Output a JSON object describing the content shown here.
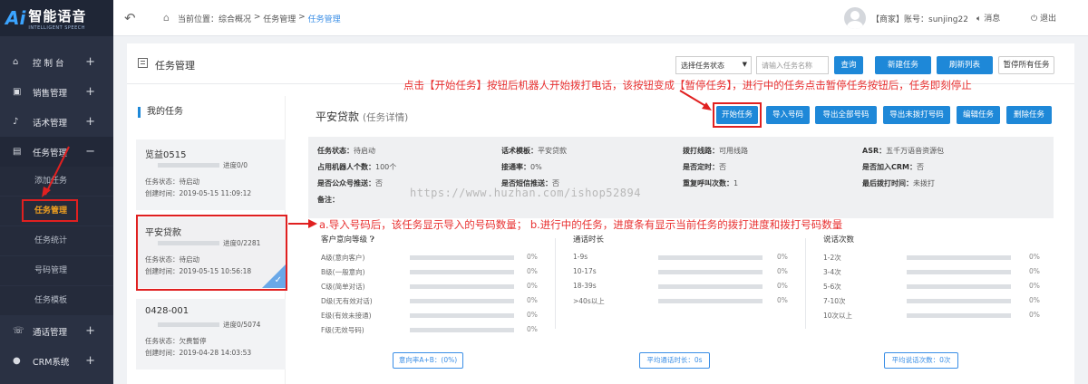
{
  "logo": {
    "ai": "Ai",
    "title": "智能语音",
    "sub": "INTELLIGENT SPEECH"
  },
  "sidebar": {
    "items": [
      {
        "label": "控 制 台",
        "icon": "home-icon",
        "sign": "+"
      },
      {
        "label": "销售管理",
        "icon": "clipboard-icon",
        "sign": "+"
      },
      {
        "label": "话术管理",
        "icon": "mic-icon",
        "sign": "+"
      },
      {
        "label": "任务管理",
        "icon": "task-icon",
        "sign": "−"
      },
      {
        "label": "通话管理",
        "icon": "phone-icon",
        "sign": "+"
      },
      {
        "label": "CRM系统",
        "icon": "user-icon",
        "sign": "+"
      }
    ],
    "subitems": [
      "添加任务",
      "任务管理",
      "任务统计",
      "号码管理",
      "任务模板"
    ]
  },
  "header": {
    "breadcrumb": [
      "当前位置：综合概况",
      "任务管理",
      "任务管理"
    ],
    "account": "【商家】账号：sunjing22",
    "message": "消息",
    "logout": "退出"
  },
  "panel": {
    "title": "任务管理",
    "status_select": "选择任务状态",
    "name_placeholder": "请输入任务名称",
    "search_btn": "查询",
    "new_btn": "新建任务",
    "refresh_btn": "刷新列表",
    "pause_all_btn": "暂停所有任务"
  },
  "annotations": {
    "top": "点击【开始任务】按钮后机器人开始拨打电话，该按钮变成【暂停任务】，进行中的任务点击暂停任务按钮后，任务即刻停止",
    "mid": "a.导入号码后，该任务显示导入的号码数量； b.进行中的任务，进度条有显示当前任务的拨打进度和拨打号码数量"
  },
  "my_tasks": {
    "heading": "我的任务",
    "tasks": [
      {
        "name": "览益0515",
        "progress": "进度0/0",
        "status": "任务状态：待启动",
        "created": "创建时间：2019-05-15 11:09:12"
      },
      {
        "name": "平安贷款",
        "progress": "进度0/2281",
        "status": "任务状态：待启动",
        "created": "创建时间：2019-05-15 10:56:18"
      },
      {
        "name": "0428-001",
        "progress": "进度0/5074",
        "status": "任务状态：欠费暂停",
        "created": "创建时间：2019-04-28 14:03:53"
      }
    ]
  },
  "detail": {
    "title": "平安贷款",
    "subtitle": "(任务详情)",
    "buttons": [
      "开始任务",
      "导入号码",
      "导出全部号码",
      "导出未拨打号码",
      "编辑任务",
      "删除任务"
    ],
    "info": [
      {
        "label": "任务状态：",
        "value": "待启动"
      },
      {
        "label": "话术模板：",
        "value": "平安贷款"
      },
      {
        "label": "拨打线路：",
        "value": "可用线路"
      },
      {
        "label": "ASR：",
        "value": "五千万语音资源包"
      },
      {
        "label": "占用机器人个数：",
        "value": "100个"
      },
      {
        "label": "接通率：",
        "value": "0%"
      },
      {
        "label": "是否定时：",
        "value": "否"
      },
      {
        "label": "是否加入CRM：",
        "value": "否"
      },
      {
        "label": "是否公众号推送：",
        "value": "否"
      },
      {
        "label": "是否短信推送：",
        "value": "否"
      },
      {
        "label": "重复呼叫次数：",
        "value": "1"
      },
      {
        "label": "最后拨打时间：",
        "value": "未拨打"
      },
      {
        "label": "备注：",
        "value": ""
      }
    ],
    "stats": {
      "intent": {
        "title": "客户意向等级",
        "rows": [
          {
            "label": "A级(意向客户)",
            "pct": "0%"
          },
          {
            "label": "B级(一般意向)",
            "pct": "0%"
          },
          {
            "label": "C级(简单对话)",
            "pct": "0%"
          },
          {
            "label": "D级(无有效对话)",
            "pct": "0%"
          },
          {
            "label": "E级(有效未接通)",
            "pct": "0%"
          },
          {
            "label": "F级(无效号码)",
            "pct": "0%"
          }
        ],
        "button": "意向率A+B：(0%)"
      },
      "duration": {
        "title": "通话时长",
        "rows": [
          {
            "label": "1-9s",
            "pct": "0%"
          },
          {
            "label": "10-17s",
            "pct": "0%"
          },
          {
            "label": "18-39s",
            "pct": "0%"
          },
          {
            "label": ">40s以上",
            "pct": "0%"
          }
        ],
        "button": "平均通话时长：0s"
      },
      "turns": {
        "title": "说话次数",
        "rows": [
          {
            "label": "1-2次",
            "pct": "0%"
          },
          {
            "label": "3-4次",
            "pct": "0%"
          },
          {
            "label": "5-6次",
            "pct": "0%"
          },
          {
            "label": "7-10次",
            "pct": "0%"
          },
          {
            "label": "10次以上",
            "pct": "0%"
          }
        ],
        "button": "平均说话次数：0次"
      }
    }
  },
  "watermark": "https://www.huzhan.com/ishop52894"
}
